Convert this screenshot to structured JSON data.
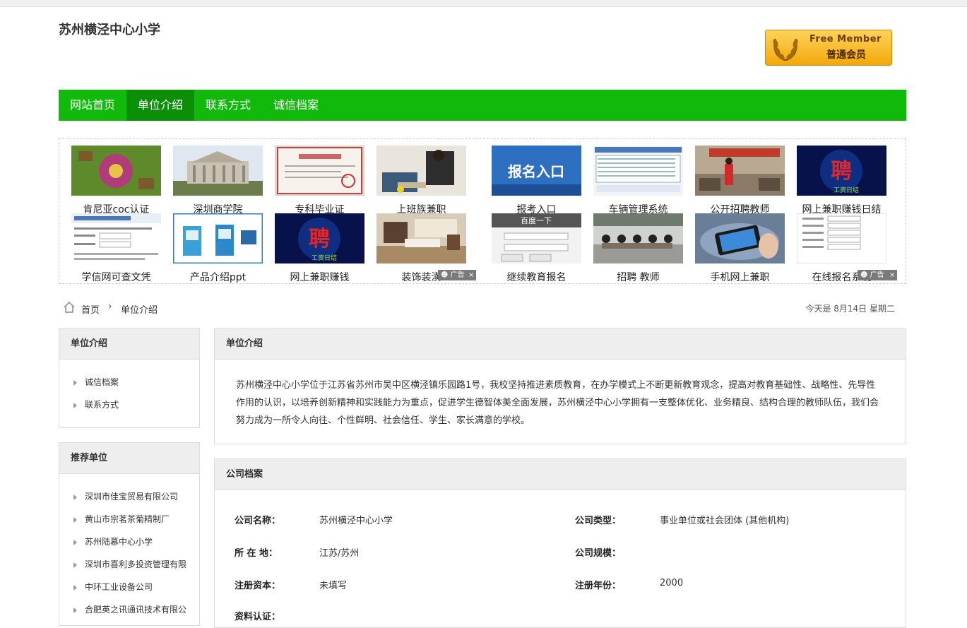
{
  "site": {
    "title": "苏州横泾中心小学"
  },
  "badge": {
    "en": "Free Member",
    "cn": "普通会员"
  },
  "nav": {
    "items": [
      "网站首页",
      "单位介绍",
      "联系方式",
      "诚信档案"
    ]
  },
  "ads": {
    "row1": [
      "肯尼亚coc认证",
      "深圳商学院",
      "专科毕业证",
      "上班族兼职",
      "报考入口",
      "车辆管理系统",
      "公开招聘教师",
      "网上兼职赚钱日结"
    ],
    "row2": [
      "学信网可查文凭",
      "产品介绍ppt",
      "网上兼职赚钱",
      "装饰装潢",
      "继续教育报名",
      "招聘 教师",
      "手机网上兼职",
      "在线报名系统"
    ],
    "tag": "广告",
    "close": "×",
    "thumb_text": {
      "baoming": "报名入口",
      "pin": "聘",
      "pin_sub": "工资日结",
      "baidu": "百度一下"
    }
  },
  "breadcrumb": {
    "home": "首页",
    "current": "单位介绍",
    "date": "今天是 8月14日 星期二"
  },
  "sidebar": {
    "about_title": "单位介绍",
    "about_items": [
      "诚信档案",
      "联系方式"
    ],
    "rec_title": "推荐单位",
    "rec_items": [
      "深圳市佳宝贸易有限公司",
      "黄山市宗茗茶菊精制厂",
      "苏州陆慕中心小学",
      "深圳市喜利多投资管理有限",
      "中环工业设备公司",
      "合肥英之讯通讯技术有限公"
    ]
  },
  "intro": {
    "title": "单位介绍",
    "text": "苏州横泾中心小学位于江苏省苏州市吴中区横泾镇乐园路1号，我校坚持推进素质教育，在办学模式上不断更新教育观念，提高对教育基础性、战略性、先导性作用的认识，以培养创新精神和实践能力为重点，促进学生德智体美全面发展，苏州横泾中心小学拥有一支整体优化、业务精良、结构合理的教师队伍，我们会努力成为一所令人向往、个性鲜明、社会信任、学生、家长满意的学校。"
  },
  "profile": {
    "title": "公司档案",
    "fields": [
      {
        "label": "公司名称：",
        "value": "苏州横泾中心小学"
      },
      {
        "label": "公司类型：",
        "value": "事业单位或社会团体 (其他机构)"
      },
      {
        "label": "所 在 地：",
        "value": "江苏/苏州"
      },
      {
        "label": "公司规模：",
        "value": ""
      },
      {
        "label": "注册资本：",
        "value": "未填写"
      },
      {
        "label": "注册年份：",
        "value": "2000"
      },
      {
        "label": "资料认证：",
        "value": ""
      }
    ]
  },
  "colors": {
    "nav": "#10b90a",
    "nav_active": "#0a8f06",
    "badge": "#f2a80b"
  }
}
